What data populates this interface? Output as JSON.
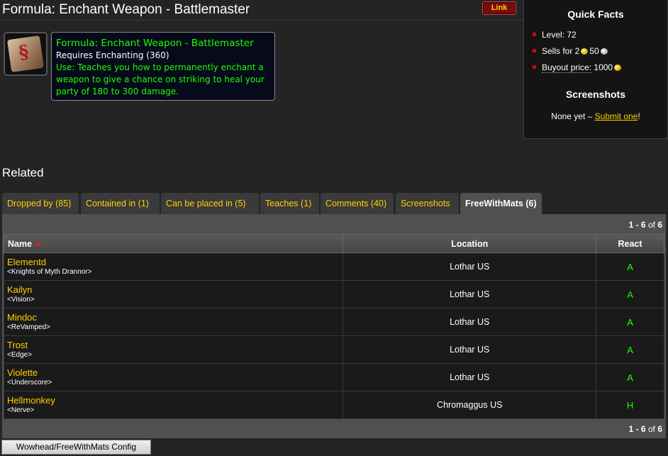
{
  "page": {
    "title": "Formula: Enchant Weapon - Battlemaster",
    "link_label": "Link"
  },
  "item": {
    "name": "Formula: Enchant Weapon - Battlemaster",
    "requires": "Requires Enchanting (360)",
    "use": "Use: Teaches you how to permanently enchant a weapon to give a chance on striking to heal your party of 180 to 300 damage."
  },
  "quick_facts": {
    "title": "Quick Facts",
    "level": "Level: 72",
    "sells_prefix": "Sells for 2",
    "sells_silver": "50",
    "buyout_label": "Buyout price:",
    "buyout_value": "1000",
    "screenshots_title": "Screenshots",
    "screenshots_none": "None yet – ",
    "submit_label": "Submit one",
    "submit_suffix": "!"
  },
  "related": {
    "title": "Related"
  },
  "tabs": [
    {
      "label": "Dropped by (85)"
    },
    {
      "label": "Contained in (1)"
    },
    {
      "label": "Can be placed in (5)"
    },
    {
      "label": "Teaches (1)"
    },
    {
      "label": "Comments (40)"
    },
    {
      "label": "Screenshots"
    },
    {
      "label": "FreeWithMats (6)"
    }
  ],
  "pagination": {
    "range": "1 - 6",
    "of": "of",
    "total": "6"
  },
  "table": {
    "headers": {
      "name": "Name",
      "location": "Location",
      "react": "React"
    },
    "rows": [
      {
        "name": "Elementd",
        "guild": "<Knights of Myth Drannor>",
        "location": "Lothar US",
        "react": "A"
      },
      {
        "name": "Kailyn",
        "guild": "<Vision>",
        "location": "Lothar US",
        "react": "A"
      },
      {
        "name": "Mindoc",
        "guild": "<ReVamped>",
        "location": "Lothar US",
        "react": "A"
      },
      {
        "name": "Trost",
        "guild": "<Edge>",
        "location": "Lothar US",
        "react": "A"
      },
      {
        "name": "Violette",
        "guild": "<Underscore>",
        "location": "Lothar US",
        "react": "A"
      },
      {
        "name": "Hellmonkey",
        "guild": "<Nerve>",
        "location": "Chromaggus US",
        "react": "H"
      }
    ]
  },
  "config": {
    "label": "Wowhead/FreeWithMats Config"
  },
  "colors": {
    "item_green": "#1eff00",
    "link_yellow": "#ffd100",
    "horde_green": "#1eff00"
  }
}
